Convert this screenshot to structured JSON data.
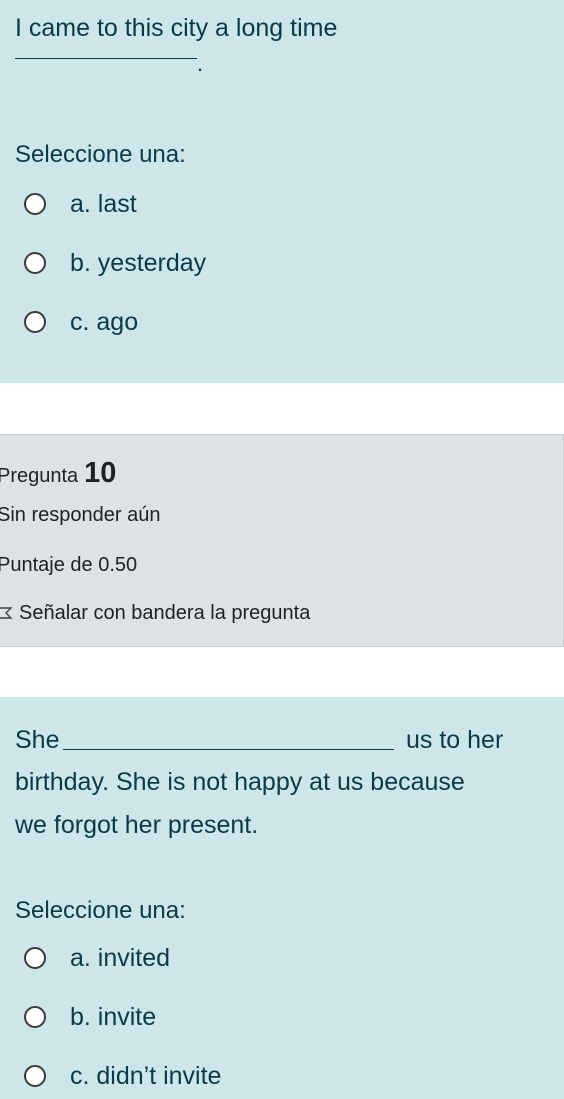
{
  "question9": {
    "text_line1": "I came to this city a long time",
    "text_line2_suffix": ".",
    "prompt": "Seleccione una:",
    "options": [
      {
        "label": "a. last"
      },
      {
        "label": "b. yesterday"
      },
      {
        "label": "c. ago"
      }
    ]
  },
  "question10_info": {
    "label": "Pregunta",
    "number": "10",
    "status": "Sin responder aún",
    "mark": "Puntaje de 0.50",
    "flag_label": "Señalar con bandera la pregunta"
  },
  "question10": {
    "text_line1_before": "She",
    "text_line1_after": "us to her",
    "text_line2": "birthday. She is not happy at us because",
    "text_line3": "we forgot her present.",
    "prompt": "Seleccione una:",
    "options": [
      {
        "label": "a. invited"
      },
      {
        "label": "b. invite"
      },
      {
        "label": "c. didn’t invite"
      }
    ]
  },
  "colors": {
    "question_bg": "#cde6ea",
    "info_bg": "#dee2e6",
    "text": "#0b3a47"
  }
}
